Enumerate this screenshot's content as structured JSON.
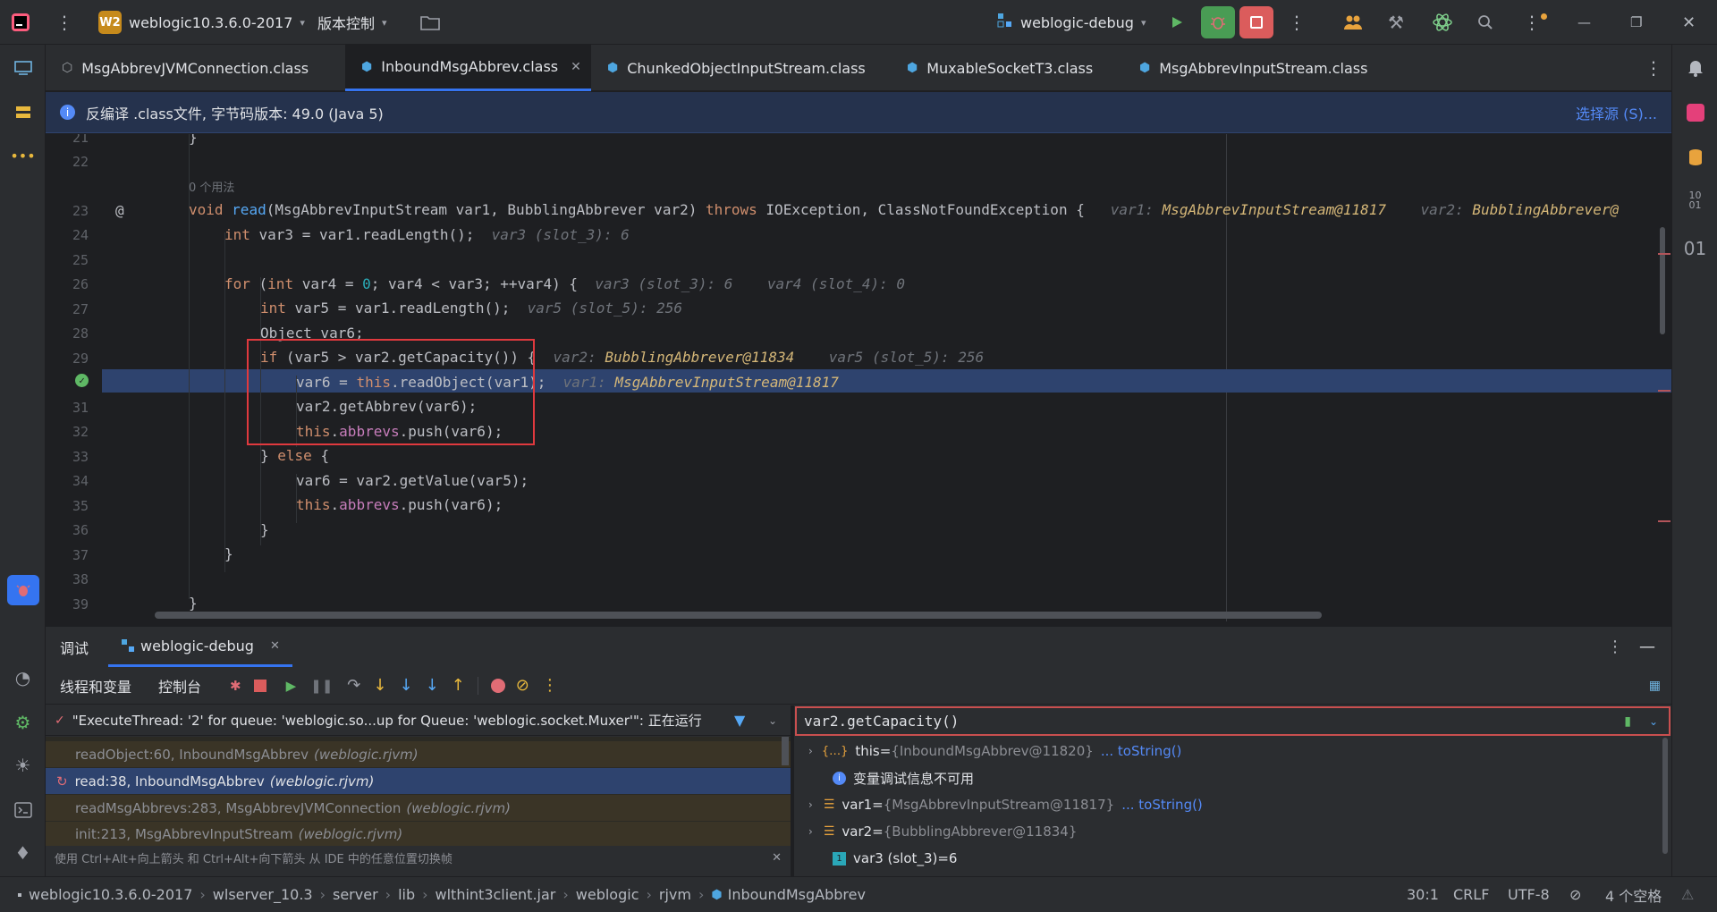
{
  "titlebar": {
    "project_badge": "W2",
    "project_name": "weblogic10.3.6.0-2017",
    "vcs_label": "版本控制",
    "run_config": "weblogic-debug"
  },
  "tabs": [
    {
      "label": "MsgAbbrevJVMConnection.class",
      "active": false
    },
    {
      "label": "InboundMsgAbbrev.class",
      "active": true
    },
    {
      "label": "ChunkedObjectInputStream.class",
      "active": false
    },
    {
      "label": "MuxableSocketT3.class",
      "active": false
    },
    {
      "label": "MsgAbbrevInputStream.class",
      "active": false
    }
  ],
  "infobar": {
    "text": "反编译 .class文件, 字节码版本: 49.0 (Java 5)",
    "action": "选择源 (S)..."
  },
  "editor": {
    "usage_hint": "0 个用法",
    "line_numbers": [
      "21",
      "22",
      "",
      "23",
      "24",
      "25",
      "26",
      "27",
      "28",
      "29",
      "30",
      "31",
      "32",
      "33",
      "34",
      "35",
      "36",
      "37",
      "38",
      "39"
    ],
    "lines": {
      "l21": "}",
      "l23_code": "void read(MsgAbbrevInputStream var1, BubblingAbbrever var2) throws IOException, ClassNotFoundException {",
      "l23_hint1k": "var1: ",
      "l23_hint1v": "MsgAbbrevInputStream@11817",
      "l23_hint2k": "var2: ",
      "l23_hint2v": "BubblingAbbrever@",
      "l24_code": "int var3 = var1.readLength();",
      "l24_hint": "var3 (slot_3): 6",
      "l26_code": "for (int var4 = 0; var4 < var3; ++var4) {",
      "l26_hint1": "var3 (slot_3): 6",
      "l26_hint2": "var4 (slot_4): 0",
      "l27_code": "int var5 = var1.readLength();",
      "l27_hint": "var5 (slot_5): 256",
      "l28_code": "Object var6;",
      "l29_code": "if (var5 > var2.getCapacity()) {",
      "l29_hint1k": "var2: ",
      "l29_hint1v": "BubblingAbbrever@11834",
      "l29_hint2": "var5 (slot_5): 256",
      "l30_code": "var6 = this.readObject(var1);",
      "l30_hintk": "var1: ",
      "l30_hintv": "MsgAbbrevInputStream@11817",
      "l31_code": "var2.getAbbrev(var6);",
      "l32_code": "this.abbrevs.push(var6);",
      "l33_code": "} else {",
      "l34_code": "var6 = var2.getValue(var5);",
      "l35_code": "this.abbrevs.push(var6);",
      "l36_code": "}",
      "l37_code": "}",
      "l39_code": "}"
    },
    "gutter_annotation": "@"
  },
  "debug": {
    "tab_debug": "调试",
    "session_name": "weblogic-debug",
    "subtab_threads": "线程和变量",
    "subtab_console": "控制台",
    "thread_text": "\"ExecuteThread: '2' for queue: 'weblogic.so...up for Queue: 'weblogic.socket.Muxer'\": 正在运行",
    "frames": [
      {
        "method": "readObject:60, InboundMsgAbbrev",
        "pkg": "(weblogic.rjvm)",
        "selected": false
      },
      {
        "method": "read:38, InboundMsgAbbrev",
        "pkg": "(weblogic.rjvm)",
        "selected": true
      },
      {
        "method": "readMsgAbbrevs:283, MsgAbbrevJVMConnection",
        "pkg": "(weblogic.rjvm)",
        "selected": false
      },
      {
        "method": "init:213, MsgAbbrevInputStream",
        "pkg": "(weblogic.rjvm)",
        "selected": false
      }
    ],
    "frames_hint": "使用 Ctrl+Alt+向上箭头 和 Ctrl+Alt+向下箭头 从 IDE 中的任意位置切换帧",
    "eval_expression": "var2.getCapacity()",
    "variables": [
      {
        "name": "this",
        "value": "{InboundMsgAbbrev@11820}",
        "link": "... toString()",
        "kind": "object",
        "expandable": true
      },
      {
        "name": "",
        "value": "变量调试信息不可用",
        "link": "",
        "kind": "info",
        "expandable": false
      },
      {
        "name": "var1",
        "value": "{MsgAbbrevInputStream@11817}",
        "link": "... toString()",
        "kind": "field",
        "expandable": true
      },
      {
        "name": "var2",
        "value": "{BubblingAbbrever@11834}",
        "link": "",
        "kind": "field",
        "expandable": true
      },
      {
        "name": "var3 (slot_3)",
        "value": "6",
        "link": "",
        "kind": "primitive",
        "expandable": false
      }
    ],
    "eq": " = "
  },
  "statusbar": {
    "breadcrumbs": [
      "weblogic10.3.6.0-2017",
      "wlserver_10.3",
      "server",
      "lib",
      "wlthint3client.jar",
      "weblogic",
      "rjvm",
      "InboundMsgAbbrev"
    ],
    "position": "30:1",
    "line_sep": "CRLF",
    "encoding": "UTF-8",
    "indent": "4 个空格"
  },
  "colors": {
    "accent": "#3574f0",
    "highlight_box": "#e0393e",
    "exec_line": "#2e436e",
    "green_run": "#499c54",
    "red_stop": "#db5c5c"
  },
  "icons": [
    "intellij-logo-icon",
    "more-vert-icon",
    "folder-icon",
    "run-config-icon",
    "run-icon",
    "debug-icon",
    "stop-icon",
    "collab-icon",
    "build-icon",
    "ai-icon",
    "search-icon",
    "settings-icon",
    "minimize-icon",
    "restore-icon",
    "close-icon"
  ]
}
